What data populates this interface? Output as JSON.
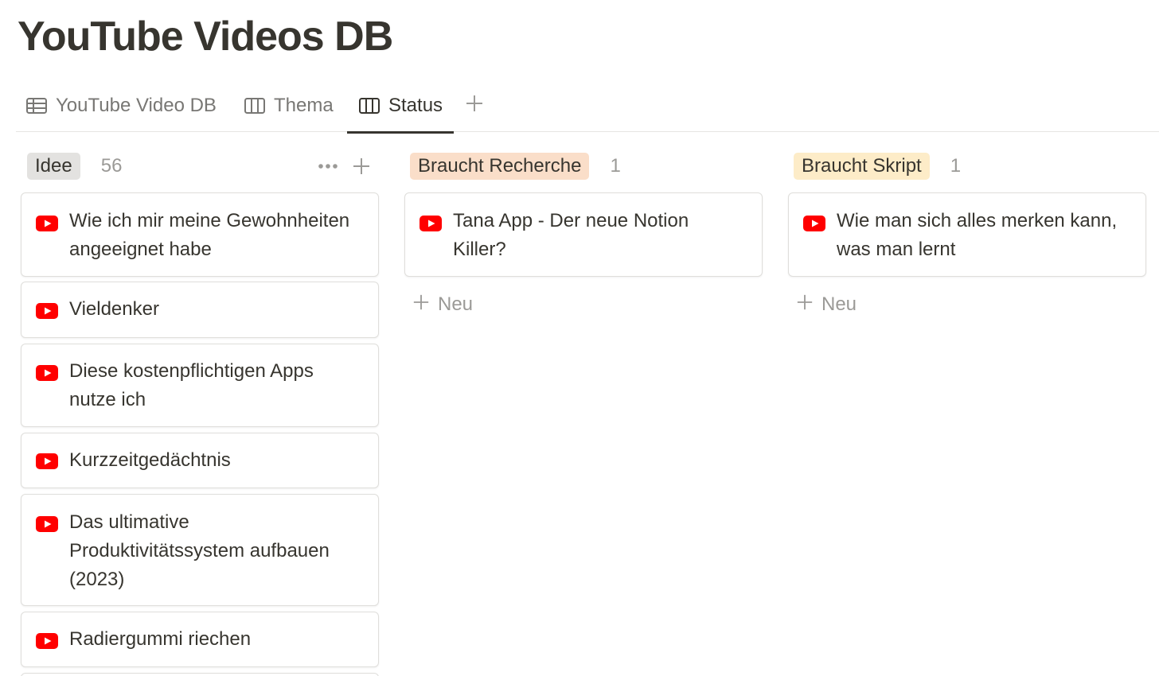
{
  "page": {
    "title": "YouTube Videos DB"
  },
  "tabs": [
    {
      "label": "YouTube Video DB",
      "icon": "table-icon"
    },
    {
      "label": "Thema",
      "icon": "board-icon"
    },
    {
      "label": "Status",
      "icon": "board-icon",
      "active": true
    }
  ],
  "columns": [
    {
      "status": "Idee",
      "count": "56",
      "pill_color": "#e3e2e0",
      "cards": [
        "Wie ich mir meine Gewohnheiten angeeignet habe",
        "Vieldenker",
        "Diese kostenpflichtigen Apps nutze ich",
        "Kurzzeitgedächtnis",
        "Das ultimative Produktivitätssystem aufbauen (2023)",
        "Radiergummi riechen"
      ]
    },
    {
      "status": "Braucht Recherche",
      "count": "1",
      "pill_color": "#fadec9",
      "cards": [
        "Tana App - Der neue Notion Killer?"
      ],
      "new_label": "Neu"
    },
    {
      "status": "Braucht Skript",
      "count": "1",
      "pill_color": "#fdecc8",
      "cards": [
        "Wie man sich alles merken kann, was man lernt"
      ],
      "new_label": "Neu"
    }
  ],
  "colors": {
    "youtube_red": "#ff0000",
    "text": "#37352f",
    "muted": "#9b9a97"
  }
}
